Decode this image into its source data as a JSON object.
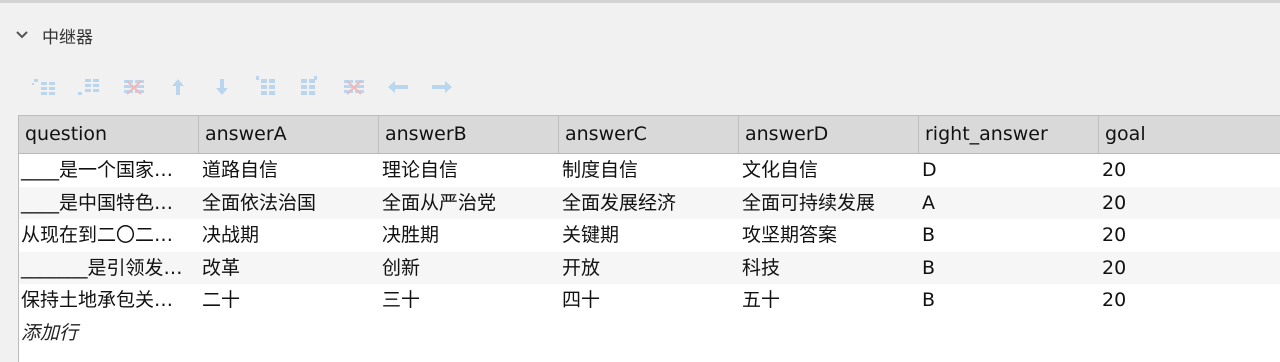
{
  "section": {
    "title": "中继器",
    "icon": "chevron-down-icon"
  },
  "toolbar": {
    "buttons": [
      {
        "name": "insert-row-above-icon"
      },
      {
        "name": "insert-row-below-icon"
      },
      {
        "name": "delete-row-icon"
      },
      {
        "name": "move-up-icon"
      },
      {
        "name": "move-down-icon"
      },
      {
        "name": "insert-column-left-icon"
      },
      {
        "name": "insert-column-right-icon"
      },
      {
        "name": "delete-column-icon"
      },
      {
        "name": "move-left-icon"
      },
      {
        "name": "move-right-icon"
      }
    ],
    "icon_color": "#b9d6ee"
  },
  "table": {
    "columns": [
      "question",
      "answerA",
      "answerB",
      "answerC",
      "answerD",
      "right_answer",
      "goal"
    ],
    "rows": [
      [
        "____是一个国家…",
        "道路自信",
        "理论自信",
        "制度自信",
        "文化自信",
        "D",
        "20"
      ],
      [
        "____是中国特色…",
        "全面依法治国",
        "全面从严治党",
        "全面发展经济",
        "全面可持续发展",
        "A",
        "20"
      ],
      [
        "从现在到二〇二…",
        "决战期",
        "决胜期",
        "关键期",
        "攻坚期答案",
        "B",
        "20"
      ],
      [
        "_______是引领发…",
        "改革",
        "创新",
        "开放",
        "科技",
        "B",
        "20"
      ],
      [
        "保持土地承包关…",
        "二十",
        "三十",
        "四十",
        "五十",
        "B",
        "20"
      ]
    ],
    "add_row_label": "添加行"
  }
}
